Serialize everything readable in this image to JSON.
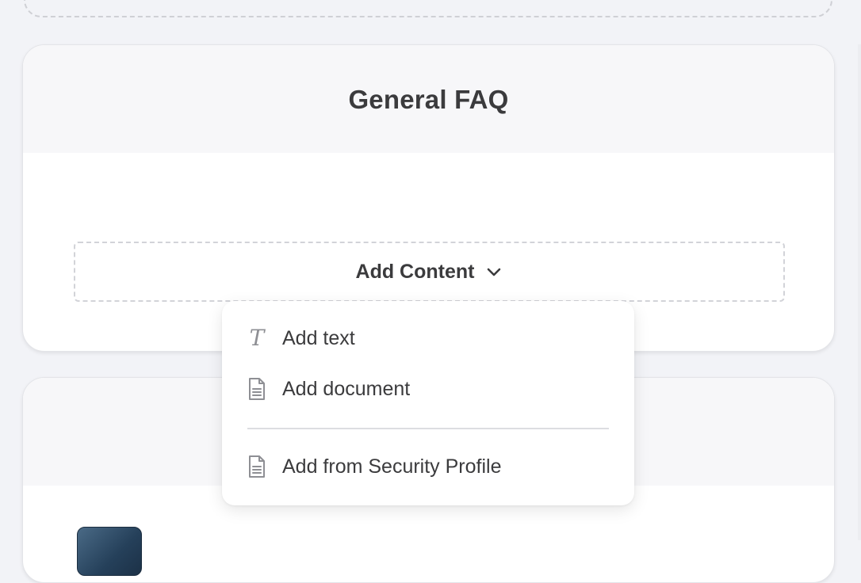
{
  "faq_card": {
    "title": "General FAQ",
    "add_content_label": "Add Content"
  },
  "menu": {
    "items": [
      {
        "label": "Add text",
        "icon": "text-format-icon"
      },
      {
        "label": "Add document",
        "icon": "document-icon"
      },
      {
        "label": "Add from Security Profile",
        "icon": "document-icon"
      }
    ]
  },
  "colors": {
    "background": "#f2f3f7",
    "card_header": "#f7f7f9",
    "text": "#3b3b3d",
    "icon": "#8e8f94",
    "dashed_border": "#d2d3d8"
  }
}
